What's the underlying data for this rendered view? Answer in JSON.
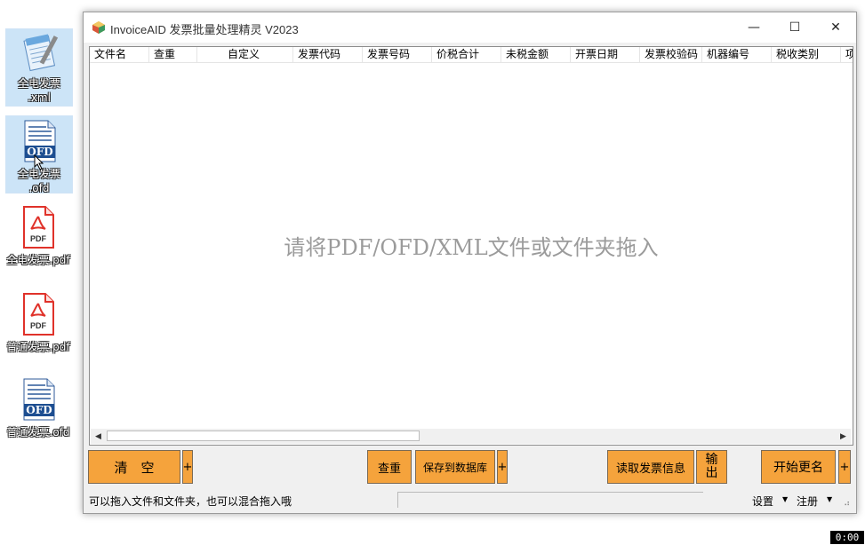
{
  "desktop": {
    "icons": [
      {
        "label": "全电发票\n.xml",
        "type": "notepad-file-icon",
        "selected": true
      },
      {
        "label": "全电发票\n.ofd",
        "type": "ofd-file-icon",
        "selected": true
      },
      {
        "label": "全电发票.pdf",
        "type": "pdf-file-icon",
        "selected": false
      },
      {
        "label": "普通发票.pdf",
        "type": "pdf-file-icon",
        "selected": false
      },
      {
        "label": "普通发票.ofd",
        "type": "ofd-file-icon",
        "selected": false
      }
    ],
    "ofd_badge": "OFD",
    "pdf_badge": "PDF"
  },
  "window": {
    "title": "InvoiceAID 发票批量处理精灵 V2023",
    "controls": {
      "minimize": "—",
      "maximize": "☐",
      "close": "✕"
    }
  },
  "list": {
    "columns": [
      "文件名",
      "查重",
      "自定义",
      "发票代码",
      "发票号码",
      "价税合计",
      "未税金额",
      "开票日期",
      "发票校验码",
      "机器编号",
      "税收类别",
      "项"
    ],
    "drop_hint": "请将PDF/OFD/XML文件或文件夹拖入"
  },
  "buttons": {
    "clear": "清　空",
    "clear_more": "+",
    "dedupe": "查重",
    "save_db": "保存到数据库",
    "save_db_more": "+",
    "read_info": "读取发票信息",
    "export": "输\n出",
    "rename": "开始更名",
    "rename_more": "+"
  },
  "status": {
    "hint": "可以拖入文件和文件夹，也可以混合拖入哦",
    "settings": "设置",
    "register": "注册",
    "caret": "▼"
  },
  "overlay": {
    "timer": "0:00"
  },
  "colors": {
    "button_orange": "#f5a33c",
    "hint_gray": "#9b9b9b"
  }
}
